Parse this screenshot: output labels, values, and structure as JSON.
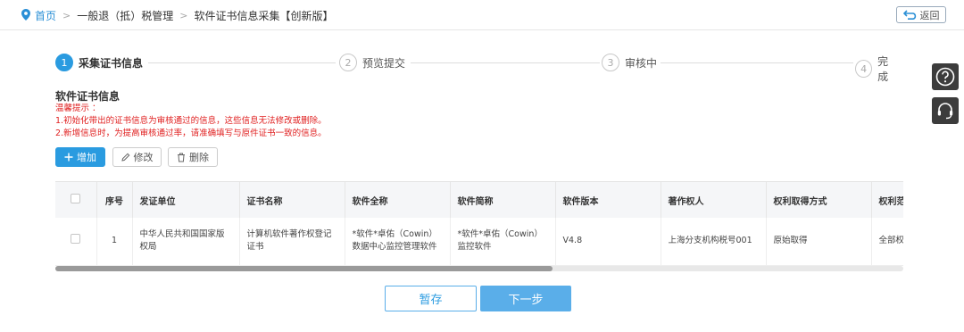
{
  "breadcrumb": {
    "home": "首页",
    "level1": "一般退（抵）税管理",
    "level2": "软件证书信息采集【创新版】"
  },
  "back_label": "返回",
  "steps": [
    {
      "num": "1",
      "label": "采集证书信息"
    },
    {
      "num": "2",
      "label": "预览提交"
    },
    {
      "num": "3",
      "label": "审核中"
    },
    {
      "num": "4",
      "label": "完成"
    }
  ],
  "section_title": "软件证书信息",
  "tips": {
    "title": "温馨提示 ：",
    "line1": "1.初始化带出的证书信息为审核通过的信息，这些信息无法修改或删除。",
    "line2": "2.新增信息时，为提高审核通过率，请准确填写与原件证书一致的信息。"
  },
  "toolbar": {
    "add": "增加",
    "edit": "修改",
    "delete": "删除"
  },
  "table": {
    "headers": [
      "序号",
      "发证单位",
      "证书名称",
      "软件全称",
      "软件简称",
      "软件版本",
      "著作权人",
      "权利取得方式",
      "权利范"
    ],
    "rows": [
      [
        "1",
        "中华人民共和国国家版权局",
        "计算机软件著作权登记证书",
        "*软件*卓佑（Cowin）数据中心监控管理软件",
        "*软件*卓佑（Cowin）监控软件",
        "V4.8",
        "上海分支机构税号001",
        "原始取得",
        "全部权"
      ]
    ]
  },
  "footer": {
    "save": "暂存",
    "next": "下一步"
  },
  "colors": {
    "primary": "#2a9be0",
    "next_button": "#5aaee9",
    "tip_text": "#e02020",
    "side_tool": "#3c3c3c"
  }
}
